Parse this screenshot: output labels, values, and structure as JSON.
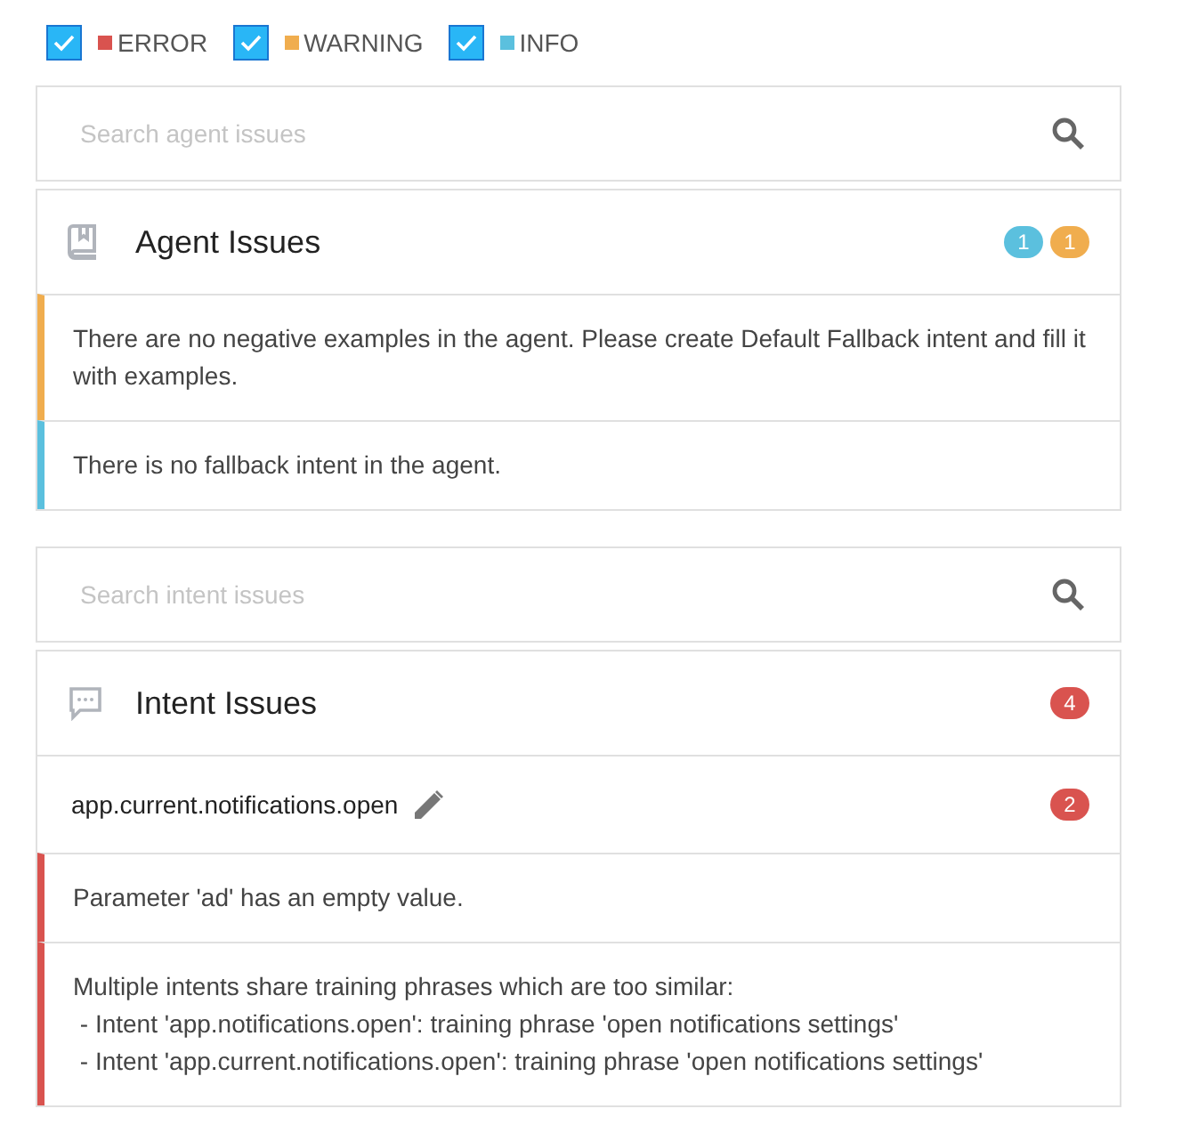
{
  "filters": [
    {
      "label": "ERROR",
      "color": "#d9534f",
      "checked": true
    },
    {
      "label": "WARNING",
      "color": "#f0ad4e",
      "checked": true
    },
    {
      "label": "INFO",
      "color": "#5bc0de",
      "checked": true
    }
  ],
  "sections": [
    {
      "search": {
        "placeholder": "Search agent issues"
      },
      "kind": "agent",
      "title": "Agent Issues",
      "badges": [
        {
          "count": "1",
          "color": "#5bc0de"
        },
        {
          "count": "1",
          "color": "#f0ad4e"
        }
      ],
      "issues": [
        {
          "color": "#f0ad4e",
          "message": "There are no negative examples in the agent. Please create Default Fallback intent and fill it with examples."
        },
        {
          "color": "#5bc0de",
          "message": "There is no fallback intent in the agent."
        }
      ]
    },
    {
      "search": {
        "placeholder": "Search intent issues"
      },
      "kind": "intent",
      "title": "Intent Issues",
      "badges": [
        {
          "count": "4",
          "color": "#d9534f"
        }
      ],
      "intents": [
        {
          "name": "app.current.notifications.open",
          "badge": {
            "count": "2",
            "color": "#d9534f"
          },
          "issues": [
            {
              "color": "#d9534f",
              "message": "Parameter 'ad' has an empty value."
            },
            {
              "color": "#d9534f",
              "message": "Multiple intents share training phrases which are too similar:\n - Intent 'app.notifications.open': training phrase 'open notifications settings'\n - Intent 'app.current.notifications.open': training phrase 'open notifications settings'"
            }
          ]
        }
      ]
    }
  ]
}
